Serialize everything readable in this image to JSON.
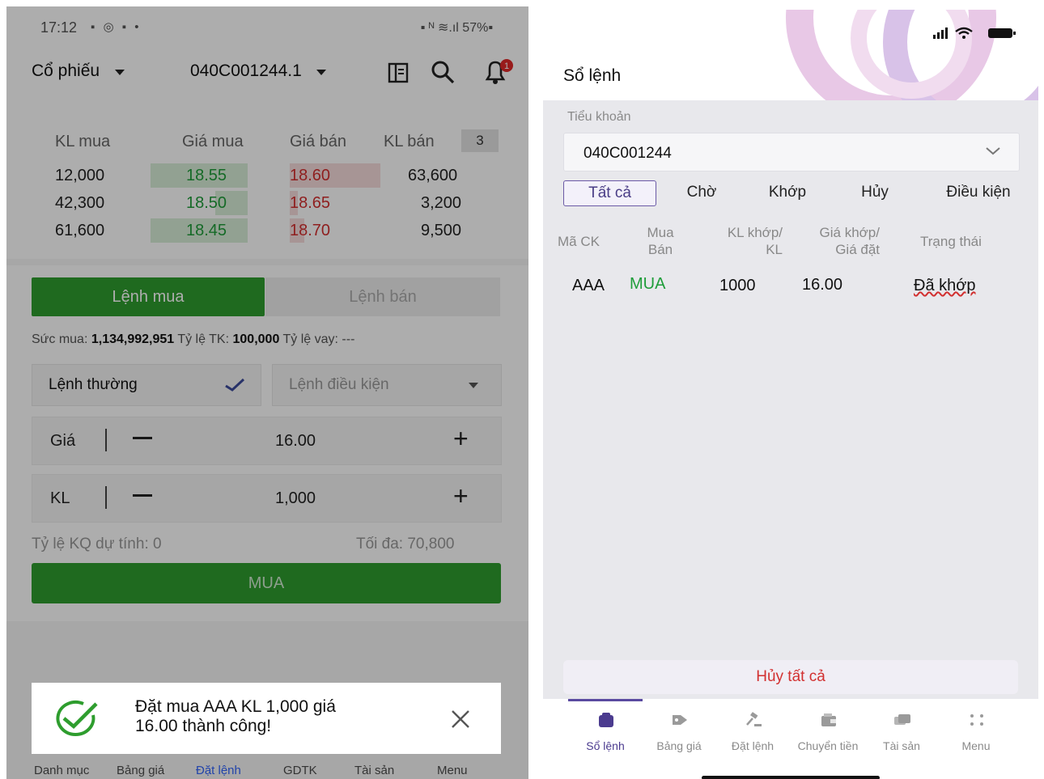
{
  "left": {
    "status": {
      "time": "17:12",
      "left_icons": "▪ ◎ ▪ •",
      "right_icons": "▪ ᴺ ≋.ıl 57%▪"
    },
    "header": {
      "category": "Cổ phiếu",
      "account": "040C001244.1",
      "notification_count": "1"
    },
    "depth": {
      "headers": [
        "KL mua",
        "Giá mua",
        "Giá bán",
        "KL bán"
      ],
      "level_badge": "3",
      "rows": [
        {
          "kl_mua": "12,000",
          "gia_mua": "18.55",
          "gia_ban": "18.60",
          "kl_ban": "63,600"
        },
        {
          "kl_mua": "42,300",
          "gia_mua": "18.50",
          "gia_ban": "18.65",
          "kl_ban": "3,200"
        },
        {
          "kl_mua": "61,600",
          "gia_mua": "18.45",
          "gia_ban": "18.70",
          "kl_ban": "9,500"
        }
      ]
    },
    "order_tabs": {
      "buy": "Lệnh mua",
      "sell": "Lệnh bán"
    },
    "buying_power": {
      "label1": "Sức mua: ",
      "value1": "1,134,992,951",
      "label2": " Tỷ lệ TK: ",
      "value2": "100,000",
      "label3": " Tỷ lệ vay: ",
      "value3": "---"
    },
    "order_type": {
      "normal": "Lệnh thường",
      "conditional": "Lệnh điều kiện"
    },
    "price": {
      "label": "Giá",
      "value": "16.00"
    },
    "quantity": {
      "label": "KL",
      "value": "1,000"
    },
    "estimate": {
      "label": "Tỷ lệ KQ dự tính: 0",
      "max": "Tối đa: 70,800"
    },
    "submit": "MUA",
    "toast": {
      "line1": "Đặt mua AAA KL 1,000 giá",
      "line2": "16.00 thành công!"
    },
    "bottom_nav": [
      "Danh mục",
      "Bảng giá",
      "Đặt lệnh",
      "GDTK",
      "Tài sản",
      "Menu"
    ]
  },
  "right": {
    "title": "Sổ lệnh",
    "account_label": "Tiểu khoản",
    "account_value": "040C001244",
    "filter_tabs": [
      "Tất cả",
      "Chờ",
      "Khớp",
      "Hủy",
      "Điều kiện"
    ],
    "columns": {
      "ma_ck": "Mã CK",
      "mua_ban_1": "Mua",
      "mua_ban_2": "Bán",
      "kl_1": "KL khớp/",
      "kl_2": "KL",
      "gia_1": "Giá khớp/",
      "gia_2": "Giá đặt",
      "status": "Trạng thái"
    },
    "rows": [
      {
        "symbol": "AAA",
        "side": "MUA",
        "qty": "1000",
        "price": "16.00",
        "status": "Đã khớp"
      }
    ],
    "cancel_all": "Hủy tất cả",
    "bottom_nav": [
      "Sổ lệnh",
      "Bảng giá",
      "Đặt lệnh",
      "Chuyển tiền",
      "Tài sản",
      "Menu"
    ],
    "colors": {
      "accent": "#6b5aa6",
      "buy_green": "#1f9d3a",
      "cancel_red": "#d23030"
    }
  }
}
